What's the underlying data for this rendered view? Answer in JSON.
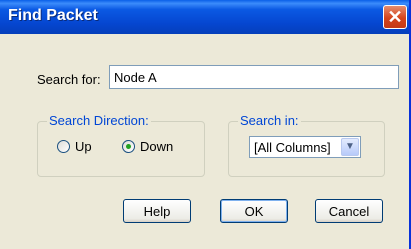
{
  "window": {
    "title": "Find Packet",
    "close_glyph": "✕"
  },
  "search": {
    "label": "Search for:",
    "value": "Node A"
  },
  "direction": {
    "legend": "Search Direction:",
    "options": [
      {
        "label": "Up",
        "selected": false
      },
      {
        "label": "Down",
        "selected": true
      }
    ]
  },
  "search_in": {
    "legend": "Search in:",
    "selected": "[All Columns]"
  },
  "buttons": {
    "help": "Help",
    "ok": "OK",
    "cancel": "Cancel"
  },
  "colors": {
    "title_bar": "#0b59e3",
    "legend_text": "#0046d5",
    "radio_dot": "#21a121",
    "close_button": "#d4431c"
  }
}
